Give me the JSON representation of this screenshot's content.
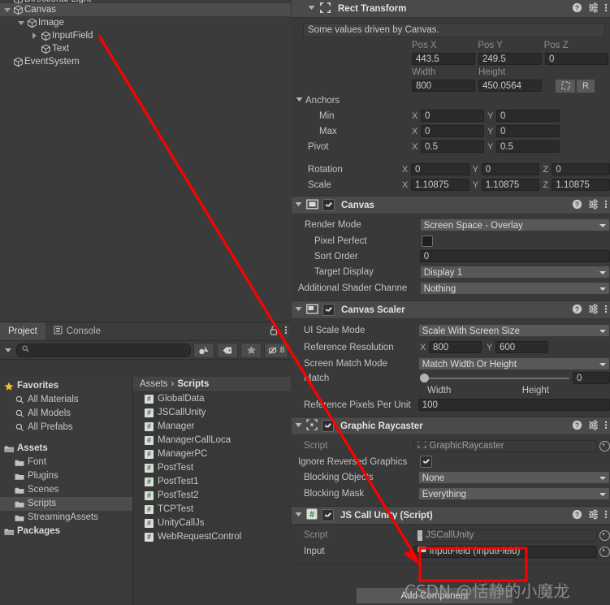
{
  "hierarchy": {
    "rows": [
      {
        "label": "Directional Light",
        "depth": 1,
        "toggle": "none",
        "selected": false,
        "partial": true
      },
      {
        "label": "Canvas",
        "depth": 1,
        "toggle": "down",
        "selected": true,
        "partial": false
      },
      {
        "label": "Image",
        "depth": 2,
        "toggle": "down",
        "selected": false,
        "partial": false
      },
      {
        "label": "InputField",
        "depth": 3,
        "toggle": "right",
        "selected": false,
        "partial": false
      },
      {
        "label": "Text",
        "depth": 3,
        "toggle": "none",
        "selected": false,
        "partial": false
      },
      {
        "label": "EventSystem",
        "depth": 1,
        "toggle": "none",
        "selected": false,
        "partial": false
      }
    ]
  },
  "project": {
    "tabs": [
      {
        "label": "Project",
        "active": true,
        "icon": "none"
      },
      {
        "label": "Console",
        "active": false,
        "icon": "console-icon"
      }
    ],
    "lock_icon": "lock-open-icon",
    "menu_icon": "kebab-menu-icon",
    "search": {
      "value": "",
      "placeholder": "",
      "icon": "search-icon"
    },
    "toolbar_icons": [
      {
        "name": "asset-filter-icon",
        "glyph": "◔"
      },
      {
        "name": "label-filter-icon",
        "glyph": "◆"
      },
      {
        "name": "favorite-filter-icon",
        "glyph": "★"
      },
      {
        "name": "hidden-packages-icon",
        "glyph": "⌀",
        "badge": "8"
      }
    ],
    "tree": [
      {
        "label": "Favorites",
        "kind": "favorites",
        "depth": 0,
        "bold": true,
        "selected": false
      },
      {
        "label": "All Materials",
        "kind": "search",
        "depth": 1,
        "bold": false,
        "selected": false
      },
      {
        "label": "All Models",
        "kind": "search",
        "depth": 1,
        "bold": false,
        "selected": false
      },
      {
        "label": "All Prefabs",
        "kind": "search",
        "depth": 1,
        "bold": false,
        "selected": false
      },
      {
        "label": "",
        "kind": "spacer",
        "depth": 0,
        "bold": false,
        "selected": false
      },
      {
        "label": "Assets",
        "kind": "folder-open",
        "depth": 0,
        "bold": true,
        "selected": false
      },
      {
        "label": "Font",
        "kind": "folder",
        "depth": 1,
        "bold": false,
        "selected": false
      },
      {
        "label": "Plugins",
        "kind": "folder",
        "depth": 1,
        "bold": false,
        "selected": false
      },
      {
        "label": "Scenes",
        "kind": "folder",
        "depth": 1,
        "bold": false,
        "selected": false
      },
      {
        "label": "Scripts",
        "kind": "folder",
        "depth": 1,
        "bold": false,
        "selected": true
      },
      {
        "label": "StreamingAssets",
        "kind": "folder",
        "depth": 1,
        "bold": false,
        "selected": false
      },
      {
        "label": "Packages",
        "kind": "folder-open",
        "depth": 0,
        "bold": true,
        "selected": false
      }
    ],
    "breadcrumb": {
      "root": "Assets",
      "separator": "›",
      "current": "Scripts"
    },
    "assets": [
      {
        "name": "GlobalData",
        "icon": "cs-script-icon"
      },
      {
        "name": "JSCallUnity",
        "icon": "cs-script-icon"
      },
      {
        "name": "Manager",
        "icon": "cs-script-icon"
      },
      {
        "name": "ManagerCallLoca",
        "icon": "cs-script-icon"
      },
      {
        "name": "ManagerPC",
        "icon": "cs-script-icon"
      },
      {
        "name": "PostTest",
        "icon": "cs-script-icon"
      },
      {
        "name": "PostTest1",
        "icon": "cs-script-icon"
      },
      {
        "name": "PostTest2",
        "icon": "cs-script-icon"
      },
      {
        "name": "TCPTest",
        "icon": "cs-script-icon"
      },
      {
        "name": "UnityCallJs",
        "icon": "cs-script-icon"
      },
      {
        "name": "WebRequestControl",
        "icon": "cs-script-icon"
      }
    ]
  },
  "inspector": {
    "rect_transform": {
      "title": "Rect Transform",
      "icon": "rect-transform-icon",
      "info": "Some values driven by Canvas.",
      "pos_labels": [
        "Pos X",
        "Pos Y",
        "Pos Z"
      ],
      "pos_values": [
        "443.5",
        "249.5",
        "0"
      ],
      "size_labels": [
        "Width",
        "Height"
      ],
      "size_values": [
        "800",
        "450.0564"
      ],
      "blueprint_icon": "blueprint-mode-icon",
      "raw_button": "R",
      "anchors_label": "Anchors",
      "anchors": [
        {
          "label": "Min",
          "x": "0",
          "y": "0"
        },
        {
          "label": "Max",
          "x": "0",
          "y": "0"
        }
      ],
      "pivot": {
        "label": "Pivot",
        "x": "0.5",
        "y": "0.5"
      },
      "rotation": {
        "label": "Rotation",
        "x": "0",
        "y": "0",
        "z": "0"
      },
      "scale": {
        "label": "Scale",
        "x": "1.10875",
        "y": "1.10875",
        "z": "1.10875"
      }
    },
    "canvas": {
      "title": "Canvas",
      "icon": "canvas-icon",
      "enabled": true,
      "render_mode": {
        "label": "Render Mode",
        "value": "Screen Space - Overlay"
      },
      "pixel_perfect": {
        "label": "Pixel Perfect",
        "checked": false
      },
      "sort_order": {
        "label": "Sort Order",
        "value": "0"
      },
      "target_display": {
        "label": "Target Display",
        "value": "Display 1"
      },
      "shader_channels": {
        "label": "Additional Shader Channe",
        "value": "Nothing"
      }
    },
    "canvas_scaler": {
      "title": "Canvas Scaler",
      "icon": "canvas-scaler-icon",
      "enabled": true,
      "ui_scale_mode": {
        "label": "UI Scale Mode",
        "value": "Scale With Screen Size"
      },
      "reference_resolution": {
        "label": "Reference Resolution",
        "x": "800",
        "y": "600"
      },
      "screen_match_mode": {
        "label": "Screen Match Mode",
        "value": "Match Width Or Height"
      },
      "match": {
        "label": "Match",
        "value": "0",
        "left": "Width",
        "right": "Height",
        "percent": 0
      },
      "reference_ppu": {
        "label": "Reference Pixels Per Unit",
        "value": "100"
      }
    },
    "graphic_raycaster": {
      "title": "Graphic Raycaster",
      "icon": "graphic-raycaster-icon",
      "enabled": true,
      "script": {
        "label": "Script",
        "value": "GraphicRaycaster"
      },
      "ignore_reversed": {
        "label": "Ignore Reversed Graphics",
        "checked": true
      },
      "blocking_objects": {
        "label": "Blocking Objects",
        "value": "None"
      },
      "blocking_mask": {
        "label": "Blocking Mask",
        "value": "Everything"
      }
    },
    "js_call_unity": {
      "title": "JS Call Unity (Script)",
      "icon": "cs-script-icon",
      "enabled": true,
      "script": {
        "label": "Script",
        "value": "JSCallUnity"
      },
      "input": {
        "label": "Input",
        "value": "InputField (InputField)"
      }
    },
    "add_component": "Add Component",
    "header_icons": {
      "help": "help-icon",
      "preset": "preset-icon",
      "menu": "kebab-menu-icon"
    }
  },
  "annotations": {
    "watermark": "CSDN @恬静的小魔龙",
    "arrow_color": "#fe0000",
    "highlight_color": "#fe0000"
  }
}
